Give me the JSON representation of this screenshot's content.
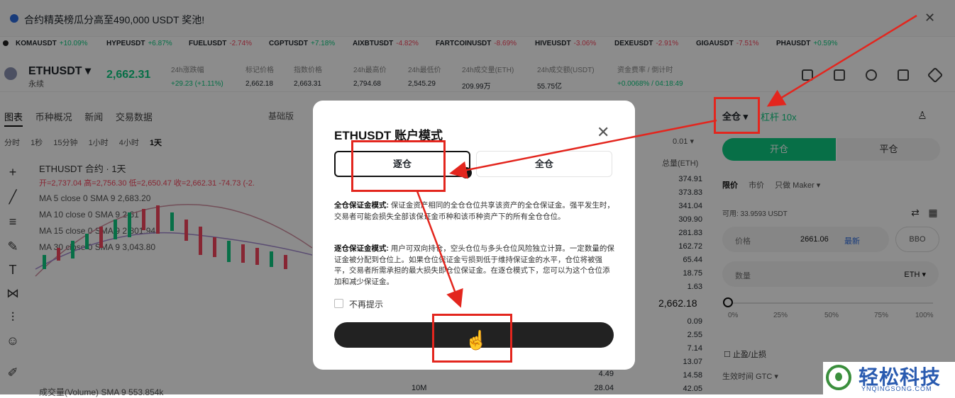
{
  "banner": {
    "text": "合约精英榜瓜分高至490,000 USDT 奖池!",
    "close": "✕"
  },
  "tickers": [
    {
      "sym": "KOMAUSDT",
      "chg": "+10.09%",
      "dir": "up"
    },
    {
      "sym": "HYPEUSDT",
      "chg": "+6.87%",
      "dir": "up"
    },
    {
      "sym": "FUELUSDT",
      "chg": "-2.74%",
      "dir": "down"
    },
    {
      "sym": "CGPTUSDT",
      "chg": "+7.18%",
      "dir": "up"
    },
    {
      "sym": "AIXBTUSDT",
      "chg": "-4.82%",
      "dir": "down"
    },
    {
      "sym": "FARTCOINUSDT",
      "chg": "-8.69%",
      "dir": "down"
    },
    {
      "sym": "HIVEUSDT",
      "chg": "-3.06%",
      "dir": "down"
    },
    {
      "sym": "DEXEUSDT",
      "chg": "-2.91%",
      "dir": "down"
    },
    {
      "sym": "GIGAUSDT",
      "chg": "-7.51%",
      "dir": "down"
    },
    {
      "sym": "PHAUSDT",
      "chg": "+0.59%",
      "dir": "up"
    }
  ],
  "symbol": {
    "name": "ETHUSDT",
    "caret": "▾",
    "type": "永续",
    "last_price": "2,662.31"
  },
  "stats": [
    {
      "label": "24h涨跌幅",
      "value": "+29.23 (+1.11%)"
    },
    {
      "label": "标记价格",
      "value": "2,662.18"
    },
    {
      "label": "指数价格",
      "value": "2,663.31"
    },
    {
      "label": "24h最高价",
      "value": "2,794.68"
    },
    {
      "label": "24h最低价",
      "value": "2,545.29"
    },
    {
      "label": "24h成交量(ETH)",
      "value": "209.99万"
    },
    {
      "label": "24h成交额(USDT)",
      "value": "55.75亿"
    },
    {
      "label": "资金费率 / 倒计时",
      "value": "+0.0068% / 04:18:49"
    }
  ],
  "chart_tabs": [
    "图表",
    "币种概况",
    "新闻",
    "交易数据"
  ],
  "chart_version": "基础版",
  "intervals": [
    "分时",
    "1秒",
    "15分钟",
    "1小时",
    "4小时",
    "1天"
  ],
  "chart": {
    "title": "ETHUSDT 合约 · 1天",
    "ohlc": "开=2,737.04  高=2,756.30  低=2,650.47  收=2,662.31  -74.73 (-2.",
    "ma": [
      "MA 5 close 0 SMA 9   2,683.20",
      "MA 10 close 0 SMA 9   2,61",
      "MA 15 close 0 SMA 9   2,801.94",
      "MA 30 close 0 SMA 9   3,043.80"
    ],
    "volume": "成交量(Volume) SMA 9   553.854k"
  },
  "orderbook": {
    "step": "0.01 ▾",
    "header": "总量(ETH)",
    "asks": [
      "374.91",
      "373.83",
      "341.04",
      "309.90",
      "281.83",
      "162.72",
      "65.44",
      "18.75",
      "1.63"
    ],
    "mid": "2,662.18",
    "bids": [
      "0.09",
      "2.55",
      "7.14",
      "13.07",
      "14.58",
      "42.05"
    ],
    "bottom_size": "10M",
    "bottom_qty": "28.04",
    "bid_extra": "4.49"
  },
  "order_panel": {
    "margin_mode": "全仓 ▾",
    "leverage": "杠杆 10x",
    "open": "开仓",
    "close": "平仓",
    "order_types": [
      "限价",
      "市价",
      "只做 Maker ▾"
    ],
    "available": "可用: 33.9593 USDT",
    "price_label": "价格",
    "price_value": "2661.06",
    "price_latest": "最新",
    "bbo": "BBO",
    "qty_label": "数量",
    "qty_unit": "ETH ▾",
    "slider_ticks": [
      "0%",
      "25%",
      "50%",
      "75%",
      "100%"
    ],
    "tpsl": "止盈/止损",
    "tif": "生效时间 GTC ▾"
  },
  "modal": {
    "title": "ETHUSDT 账户模式",
    "option_isolated": "逐仓",
    "option_cross": "全仓",
    "cross_title": "全仓保证金模式:",
    "cross_desc": "保证金资产相同的全仓仓位共享该资产的全仓保证金。强平发生时，交易者可能会损失全部该保证金币种和该币种资产下的所有全仓仓位。",
    "iso_title": "逐仓保证金模式:",
    "iso_desc": "用户可双向持仓，空头仓位与多头仓位风险独立计算。一定数量的保证金被分配到仓位上。如果仓位保证金亏损到低于维持保证金的水平，仓位将被强平，交易者所需承担的最大损失即仓位保证金。在逐仓模式下，您可以为这个仓位添加和减少保证金。",
    "no_remind": "不再提示"
  },
  "watermark": {
    "title": "轻松科技",
    "sub": "YNQINGSONG.COM"
  },
  "colors": {
    "up": "#0ecb81",
    "down": "#f6465d",
    "annotation": "#e3261e"
  }
}
